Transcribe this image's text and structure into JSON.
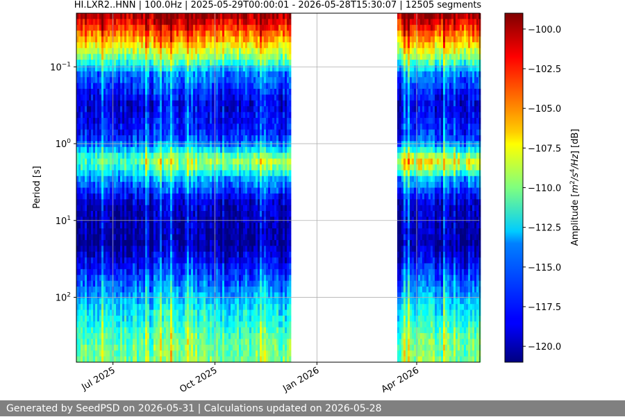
{
  "chart_data": {
    "type": "heatmap",
    "title": "HI.LXR2..HNN | 100.0Hz | 2025-05-29T00:00:01 - 2026-05-28T15:30:07 | 12505 segments",
    "xlabel": "",
    "ylabel": "Period [s]",
    "y_scale": "log",
    "y_inverted": true,
    "y_range_s": [
      0.02,
      700
    ],
    "y_ticks": [
      {
        "value": 0.1,
        "label": "10^-1",
        "base": "10",
        "exp": "−1"
      },
      {
        "value": 1,
        "label": "10^0",
        "base": "10",
        "exp": "0"
      },
      {
        "value": 10,
        "label": "10^1",
        "base": "10",
        "exp": "1"
      },
      {
        "value": 100,
        "label": "10^2",
        "base": "10",
        "exp": "2"
      }
    ],
    "x_range": [
      "2025-05-29",
      "2026-05-28"
    ],
    "x_ticks": [
      {
        "date": "2025-07-01",
        "label": "Jul 2025"
      },
      {
        "date": "2025-10-01",
        "label": "Oct 2025"
      },
      {
        "date": "2026-01-01",
        "label": "Jan 2026"
      },
      {
        "date": "2026-04-01",
        "label": "Apr 2026"
      }
    ],
    "data_gaps": [
      {
        "start": "2025-12-08",
        "end": "2026-03-14"
      }
    ],
    "grid": true,
    "colorbar": {
      "label": "Amplitude [m²/s⁴/Hz] [dB]",
      "label_parts": [
        "Amplitude [",
        "m",
        "2",
        "/",
        "s",
        "4",
        "/",
        "Hz",
        "] [dB]"
      ],
      "colormap": "jet",
      "range": [
        -121,
        -99
      ],
      "ticks": [
        -100.0,
        -102.5,
        -105.0,
        -107.5,
        -110.0,
        -112.5,
        -115.0,
        -117.5,
        -120.0
      ],
      "tick_labels": [
        "−100.0",
        "−102.5",
        "−105.0",
        "−107.5",
        "−110.0",
        "−112.5",
        "−115.0",
        "−117.5",
        "−120.0"
      ]
    },
    "amplitude_profile_by_period": [
      {
        "period_s": 0.02,
        "db": -99.5
      },
      {
        "period_s": 0.03,
        "db": -102.5
      },
      {
        "period_s": 0.05,
        "db": -106.5
      },
      {
        "period_s": 0.08,
        "db": -110.5
      },
      {
        "period_s": 0.12,
        "db": -115.5
      },
      {
        "period_s": 0.3,
        "db": -119
      },
      {
        "period_s": 0.8,
        "db": -117.5
      },
      {
        "period_s": 1.6,
        "db": -112
      },
      {
        "period_s": 3,
        "db": -115
      },
      {
        "period_s": 6,
        "db": -119.5
      },
      {
        "period_s": 20,
        "db": -120.5
      },
      {
        "period_s": 50,
        "db": -117
      },
      {
        "period_s": 150,
        "db": -113
      },
      {
        "period_s": 400,
        "db": -110.5
      },
      {
        "period_s": 700,
        "db": -110
      }
    ]
  },
  "footer": {
    "text": "Generated by SeedPSD on 2026-05-31 | Calculations updated on 2026-05-28"
  }
}
